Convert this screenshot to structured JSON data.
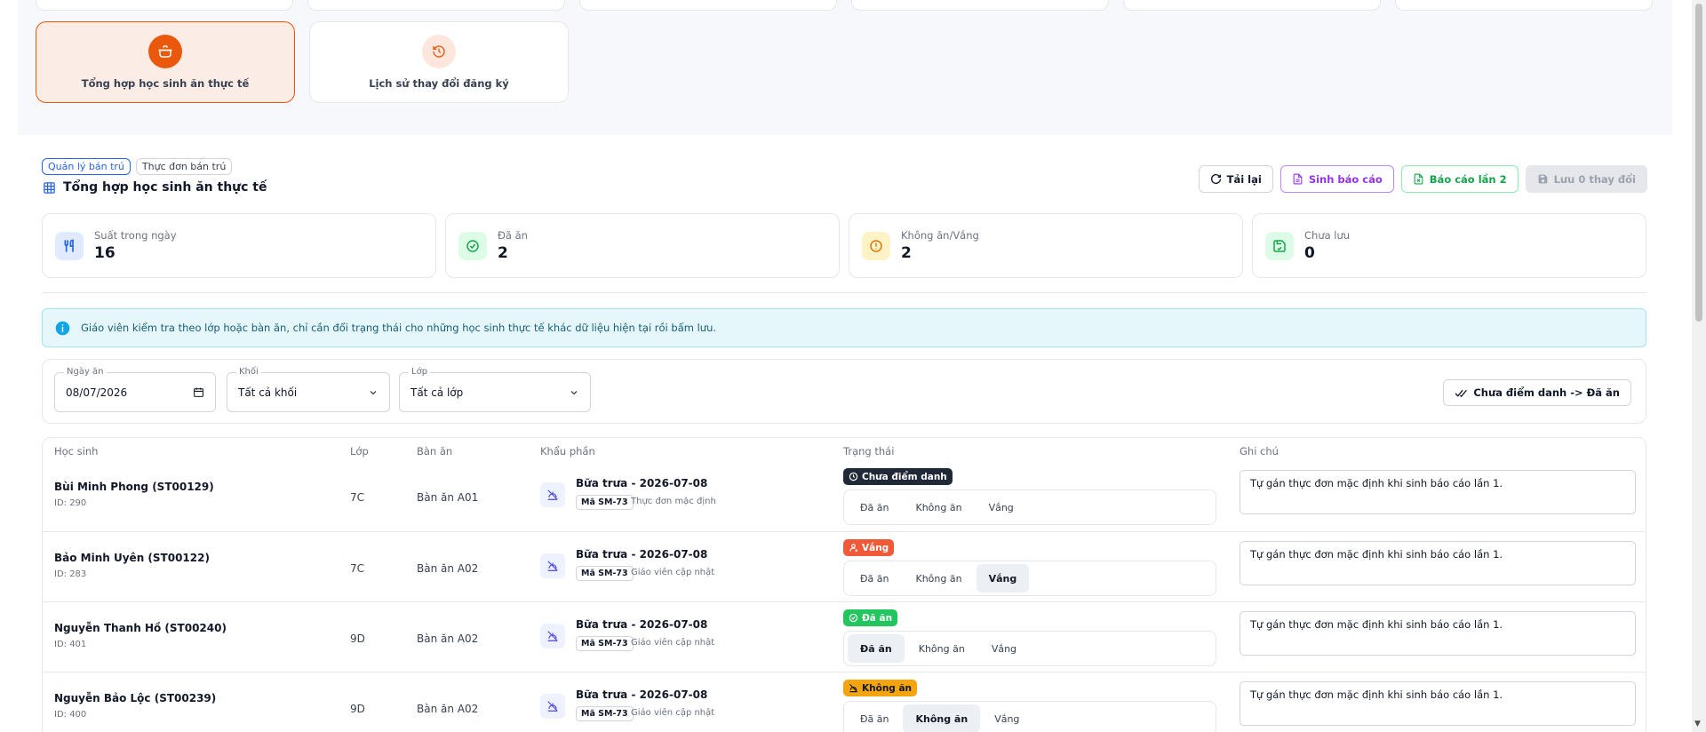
{
  "nav_cards": [
    {
      "label": "Tổng hợp học sinh ăn thực tế",
      "icon": "pot-icon",
      "active": true
    },
    {
      "label": "Lịch sử thay đổi đăng ký",
      "icon": "history-icon",
      "active": false
    }
  ],
  "breadcrumbs": [
    "Quản lý bán trú",
    "Thực đơn bán trú"
  ],
  "page": {
    "title": "Tổng hợp học sinh ăn thực tế"
  },
  "actions": {
    "reload": "Tải lại",
    "report": "Sinh báo cáo",
    "report2": "Báo cáo lần 2",
    "save": "Lưu 0 thay đổi"
  },
  "stats": [
    {
      "label": "Suất trong ngày",
      "value": "16",
      "icon": "utensils-icon",
      "color": "#2563eb"
    },
    {
      "label": "Đã ăn",
      "value": "2",
      "icon": "check-circle-icon",
      "color": "#16a34a"
    },
    {
      "label": "Không ăn/Vắng",
      "value": "2",
      "icon": "alert-circle-icon",
      "color": "#d97706"
    },
    {
      "label": "Chưa lưu",
      "value": "0",
      "icon": "save-icon",
      "color": "#16a34a"
    }
  ],
  "info": {
    "text": "Giáo viên kiểm tra theo lớp hoặc bàn ăn, chỉ cần đổi trạng thái cho những học sinh thực tế khác dữ liệu hiện tại rồi bấm lưu."
  },
  "filters": {
    "date_label": "Ngày ăn",
    "date_value": "08/07/2026",
    "grade_label": "Khối",
    "grade_value": "Tất cả khối",
    "class_label": "Lớp",
    "class_value": "Tất cả lớp",
    "mark_button": "Chưa điểm danh -> Đã ăn"
  },
  "table": {
    "headers": [
      "Học sinh",
      "Lớp",
      "Bàn ăn",
      "Khẩu phần",
      "Trạng thái",
      "Ghi chú"
    ],
    "options": [
      "Đã ăn",
      "Không ăn",
      "Vắng"
    ],
    "rows": [
      {
        "name": "Bùi Minh Phong (ST00129)",
        "id": "ID: 290",
        "class": "7C",
        "table": "Bàn ăn A01",
        "meal": "Bữa trưa - 2026-07-08",
        "code": "Mã SM-73",
        "menu_note": "Thực đơn mặc định",
        "status": "Chưa điểm danh",
        "selected": "",
        "note": "Tự gán thực đơn mặc định khi sinh báo cáo lần 1."
      },
      {
        "name": "Bảo Minh Uyên (ST00122)",
        "id": "ID: 283",
        "class": "7C",
        "table": "Bàn ăn A02",
        "meal": "Bữa trưa - 2026-07-08",
        "code": "Mã SM-73",
        "menu_note": "Giáo viên cập nhật",
        "status": "Vắng",
        "selected": "Vắng",
        "note": "Tự gán thực đơn mặc định khi sinh báo cáo lần 1."
      },
      {
        "name": "Nguyễn Thanh Hồ (ST00240)",
        "id": "ID: 401",
        "class": "9D",
        "table": "Bàn ăn A02",
        "meal": "Bữa trưa - 2026-07-08",
        "code": "Mã SM-73",
        "menu_note": "Giáo viên cập nhật",
        "status": "Đã ăn",
        "selected": "Đã ăn",
        "note": "Tự gán thực đơn mặc định khi sinh báo cáo lần 1."
      },
      {
        "name": "Nguyễn Bảo Lộc (ST00239)",
        "id": "ID: 400",
        "class": "9D",
        "table": "Bàn ăn A02",
        "meal": "Bữa trưa - 2026-07-08",
        "code": "Mã SM-73",
        "menu_note": "Giáo viên cập nhật",
        "status": "Không ăn",
        "selected": "Không ăn",
        "note": "Tự gán thực đơn mặc định khi sinh báo cáo lần 1."
      }
    ]
  },
  "status_colors": {
    "Chưa điểm danh": "#1f2937",
    "Vắng": "#f05a38",
    "Đã ăn": "#22c55e",
    "Không ăn": "#f5a50b"
  }
}
